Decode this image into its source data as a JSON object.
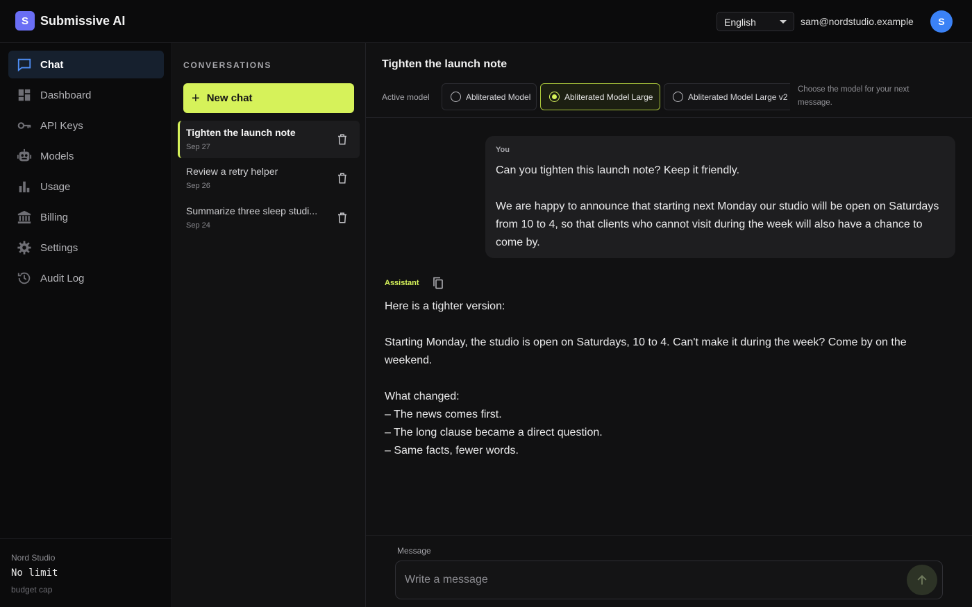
{
  "brand": {
    "logo_letter": "S",
    "name": "Submissive AI"
  },
  "header": {
    "language": "English",
    "user_email": "sam@nordstudio.example",
    "avatar_letter": "S"
  },
  "nav": {
    "items": [
      {
        "label": "Chat",
        "icon": "chat-icon",
        "active": true
      },
      {
        "label": "Dashboard",
        "icon": "dashboard-icon",
        "active": false
      },
      {
        "label": "API Keys",
        "icon": "key-icon",
        "active": false
      },
      {
        "label": "Models",
        "icon": "robot-icon",
        "active": false
      },
      {
        "label": "Usage",
        "icon": "bar-chart-icon",
        "active": false
      },
      {
        "label": "Billing",
        "icon": "bank-icon",
        "active": false
      },
      {
        "label": "Settings",
        "icon": "gear-icon",
        "active": false
      },
      {
        "label": "Audit Log",
        "icon": "history-icon",
        "active": false
      }
    ],
    "footer": {
      "org": "Nord Studio",
      "plan": "No limit",
      "plan_note": "budget cap"
    }
  },
  "conversations": {
    "header": "CONVERSATIONS",
    "new_chat_label": "New chat",
    "items": [
      {
        "title": "Tighten the launch note",
        "date": "Sep 27",
        "active": true
      },
      {
        "title": "Review a retry helper",
        "date": "Sep 26",
        "active": false
      },
      {
        "title": "Summarize three sleep studi...",
        "date": "Sep 24",
        "active": false
      }
    ]
  },
  "chat": {
    "title": "Tighten the launch note",
    "active_model_label": "Active model",
    "models": [
      {
        "label": "Abliterated Model",
        "selected": false
      },
      {
        "label": "Abliterated Model Large",
        "selected": true
      },
      {
        "label": "Abliterated Model Large v2",
        "selected": false
      }
    ],
    "model_hint": "Choose the model for your next message.",
    "messages": {
      "user_role": "You",
      "user_text": "Can you tighten this launch note? Keep it friendly.\n\nWe are happy to announce that starting next Monday our studio will be open on Saturdays from 10 to 4, so that clients who cannot visit during the week will also have a chance to come by.",
      "assistant_role": "Assistant",
      "assistant_text": "Here is a tighter version:\n\nStarting Monday, the studio is open on Saturdays, 10 to 4. Can't make it during the week? Come by on the weekend.\n\nWhat changed:\n– The news comes first.\n– The long clause became a direct question.\n– Same facts, fewer words."
    },
    "composer": {
      "label": "Message",
      "placeholder": "Write a message",
      "value": ""
    }
  },
  "colors": {
    "accent": "#d6f25a",
    "avatar": "#3b82f6",
    "brand_logo": "#6a6ef5"
  }
}
